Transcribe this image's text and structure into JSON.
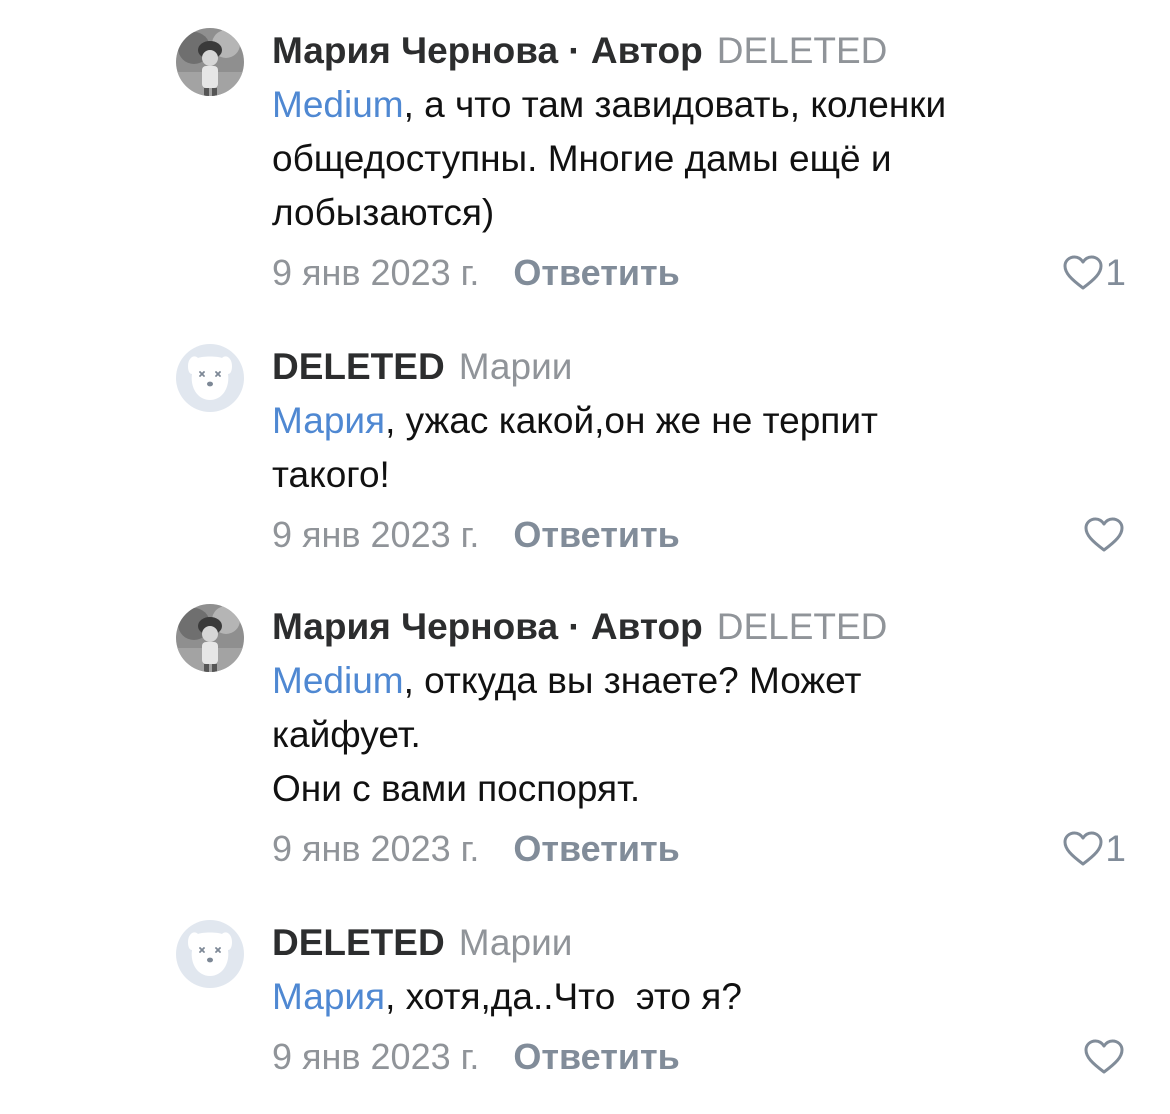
{
  "comments": [
    {
      "author": "Мария Чернова · Автор",
      "reply_to": "DELETED",
      "mention": "Medium",
      "lines": [
        "а что там завидовать, коленки",
        "общедоступны. Многие дамы ещё и",
        "лобызаются)"
      ],
      "date": "9 янв 2023 г.",
      "reply_label": "Ответить",
      "likes": "1",
      "avatar_icon": "profile-photo"
    },
    {
      "author": "DELETED",
      "reply_to": "Марии",
      "mention": "Мария",
      "lines": [
        "ужас какой,он же не терпит",
        "такого!"
      ],
      "date": "9 янв 2023 г.",
      "reply_label": "Ответить",
      "likes": "",
      "avatar_icon": "deleted-dog-icon"
    },
    {
      "author": "Мария Чернова · Автор",
      "reply_to": "DELETED",
      "mention": "Medium",
      "lines": [
        "откуда вы знаете? Может",
        "кайфует.",
        "Они с вами поспорят."
      ],
      "date": "9 янв 2023 г.",
      "reply_label": "Ответить",
      "likes": "1",
      "avatar_icon": "profile-photo"
    },
    {
      "author": "DELETED",
      "reply_to": "Марии",
      "mention": "Мария",
      "lines": [
        "хотя,да..Что  это я?"
      ],
      "date": "9 янв 2023 г.",
      "reply_label": "Ответить",
      "likes": "",
      "avatar_icon": "deleted-dog-icon"
    }
  ],
  "colors": {
    "mention": "#4f88d2",
    "secondary_text": "#909499",
    "action": "#818c99"
  }
}
